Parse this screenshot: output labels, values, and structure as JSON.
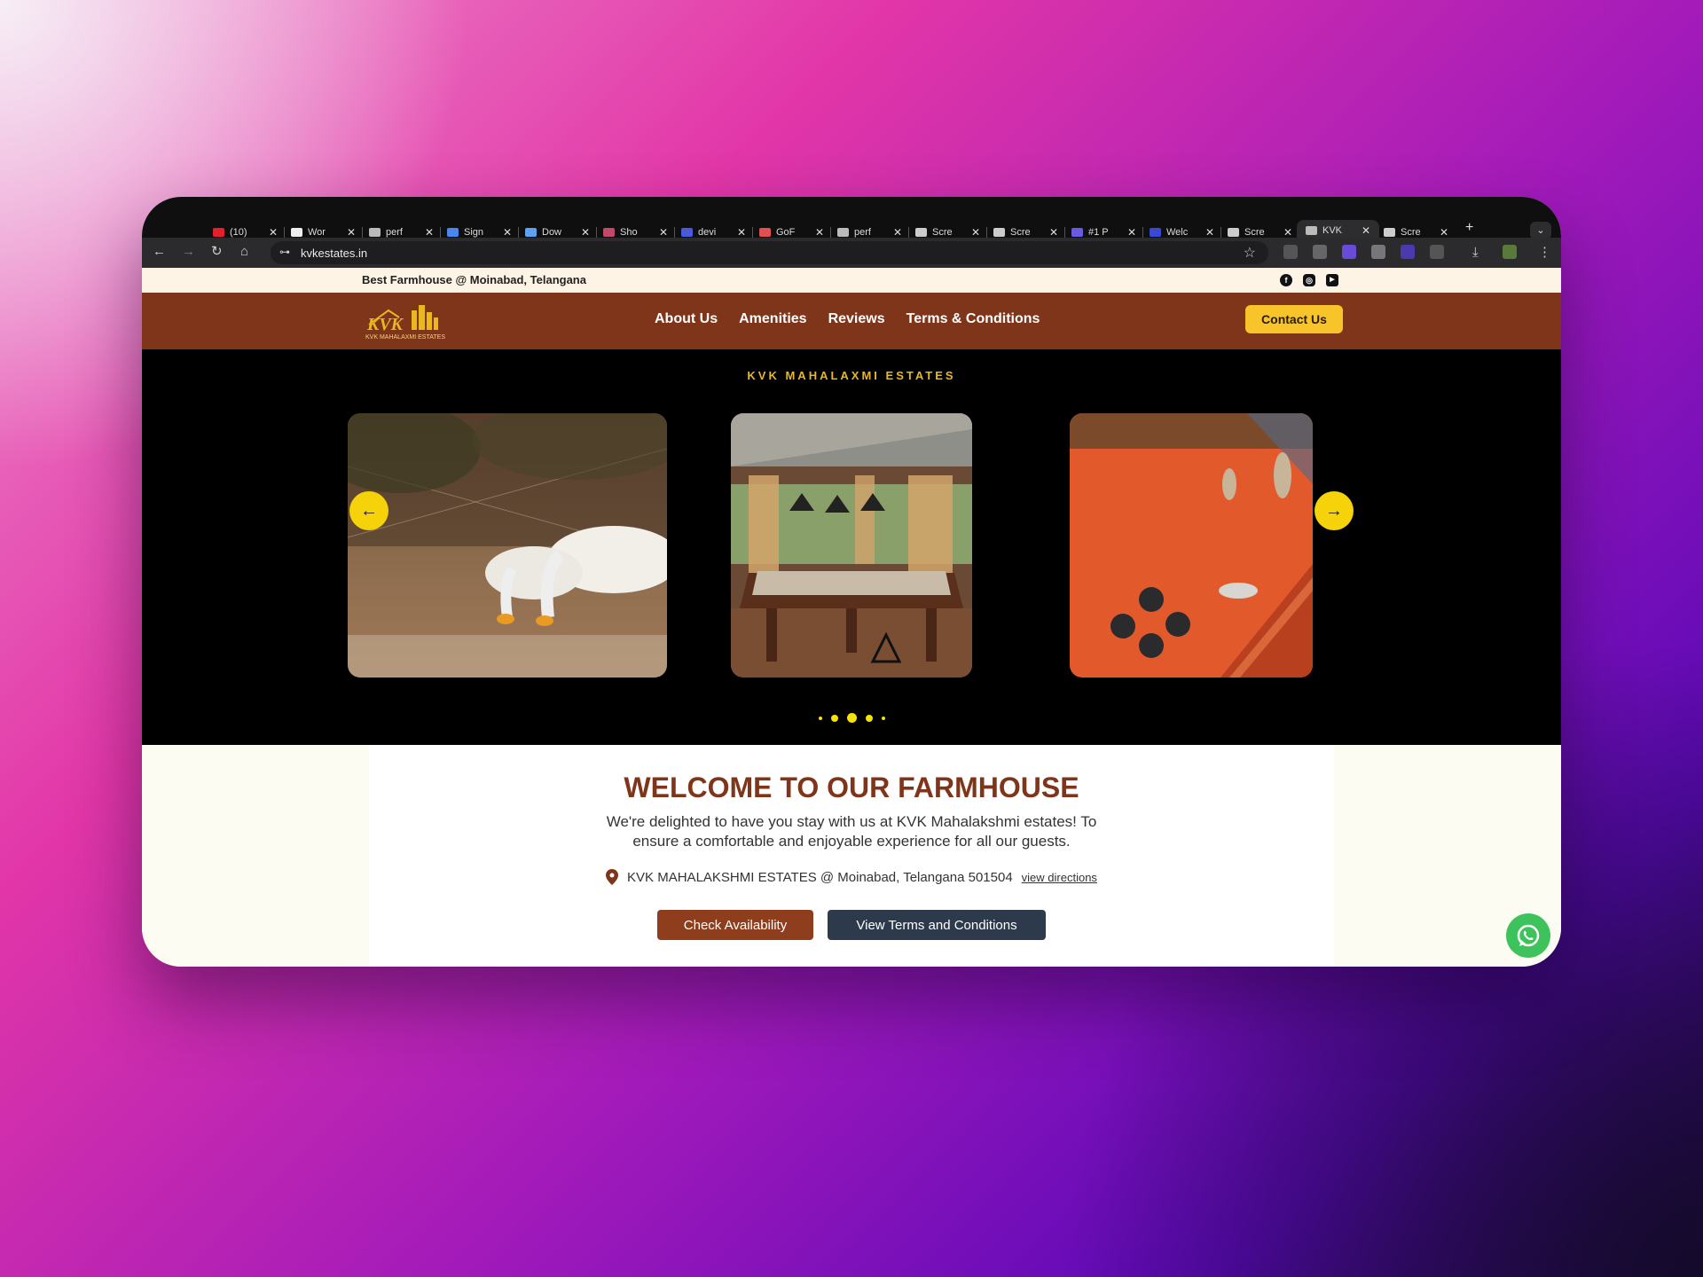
{
  "browser": {
    "tabs": [
      {
        "title": "(10)",
        "color": "#e4202a"
      },
      {
        "title": "Wor",
        "color": "#eeeeee"
      },
      {
        "title": "perf",
        "color": "#bbbbbb"
      },
      {
        "title": "Sign",
        "color": "#4a86ee"
      },
      {
        "title": "Dow",
        "color": "#5fa0f0"
      },
      {
        "title": "Sho",
        "color": "#c0486a"
      },
      {
        "title": "devi",
        "color": "#4a5ad8"
      },
      {
        "title": "GoF",
        "color": "#e05050"
      },
      {
        "title": "perf",
        "color": "#bbbbbb"
      },
      {
        "title": "Scre",
        "color": "#cccccc"
      },
      {
        "title": "Scre",
        "color": "#cccccc"
      },
      {
        "title": "#1 P",
        "color": "#6a5ae0"
      },
      {
        "title": "Welc",
        "color": "#3a4ad0"
      },
      {
        "title": "Scre",
        "color": "#cccccc"
      },
      {
        "title": "KVK",
        "color": "#bbbbbb",
        "active": true
      },
      {
        "title": "Scre",
        "color": "#cccccc"
      }
    ],
    "url": "kvkestates.in",
    "close_glyph": "✕",
    "new_tab_glyph": "+",
    "tab_menu_glyph": "⌄",
    "icons": {
      "back": "←",
      "forward": "→",
      "reload": "↻",
      "home": "⌂",
      "star": "☆",
      "tune": "⊶",
      "download": "⤓",
      "menu": "⋮"
    }
  },
  "site": {
    "tagline": "Best Farmhouse @ Moinabad, Telangana",
    "social": [
      {
        "name": "facebook-icon",
        "glyph": "f"
      },
      {
        "name": "instagram-icon",
        "glyph": "◎"
      },
      {
        "name": "youtube-icon",
        "glyph": "▶"
      }
    ],
    "logo_text": "KVK MAHALAXMI ESTATES",
    "logo_mark": "KVK",
    "nav": [
      "About Us",
      "Amenities",
      "Reviews",
      "Terms & Conditions"
    ],
    "contact_label": "Contact Us",
    "hero": {
      "title": "KVK MAHALAXMI ESTATES",
      "prev_glyph": "←",
      "next_glyph": "→",
      "active_dot": 2,
      "dot_count": 5
    },
    "welcome": {
      "title": "WELCOME TO OUR FARMHOUSE",
      "text": "We're delighted to have you stay with us at KVK Mahalakshmi estates! To ensure a comfortable and enjoyable experience for all our guests.",
      "address": "KVK MAHALAKSHMI ESTATES @ Moinabad, Telangana 501504",
      "directions_label": "view directions",
      "check_label": "Check Availability",
      "terms_label": "View Terms and Conditions"
    },
    "colors": {
      "brand_brown": "#7f3519",
      "accent_yellow": "#f7c52a",
      "whatsapp": "#3ec35c"
    }
  }
}
